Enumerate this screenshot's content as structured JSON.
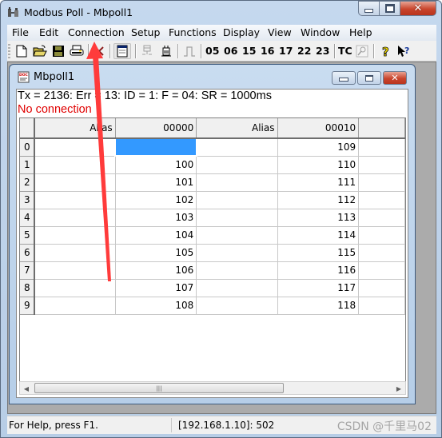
{
  "window": {
    "title": "Modbus Poll - Mbpoll1",
    "controls": {
      "minimize": "minimize",
      "maximize": "maximize",
      "close": "close"
    }
  },
  "menu": {
    "items": [
      {
        "label": "File"
      },
      {
        "label": "Edit"
      },
      {
        "label": "Connection"
      },
      {
        "label": "Setup"
      },
      {
        "label": "Functions"
      },
      {
        "label": "Display"
      },
      {
        "label": "View"
      },
      {
        "label": "Window"
      },
      {
        "label": "Help"
      }
    ]
  },
  "toolbar": {
    "icons": [
      "new-document-icon",
      "open-folder-icon",
      "save-icon",
      "print-icon",
      "delete-icon",
      "window-icon",
      "connect-icon",
      "disconnect-icon",
      "pulse-icon"
    ],
    "function_codes": [
      "05",
      "06",
      "15",
      "16",
      "17",
      "22",
      "23"
    ],
    "tc_label": "TC",
    "extra_icons": [
      "traffic-monitor-icon",
      "help-icon",
      "context-help-icon"
    ]
  },
  "child_window": {
    "title": "Mbpoll1",
    "status_line": "Tx = 2136: Err = 13: ID = 1: F = 04: SR = 1000ms",
    "error_line": "No connection",
    "error_color": "#e00000",
    "grid": {
      "columns": [
        {
          "label": "Alias"
        },
        {
          "label": "00000"
        },
        {
          "label": "Alias"
        },
        {
          "label": "00010"
        }
      ],
      "rows": [
        {
          "index": "0",
          "alias1": "",
          "value1": "",
          "alias2": "",
          "value2": "109",
          "selected": true
        },
        {
          "index": "1",
          "alias1": "",
          "value1": "100",
          "alias2": "",
          "value2": "110"
        },
        {
          "index": "2",
          "alias1": "",
          "value1": "101",
          "alias2": "",
          "value2": "111"
        },
        {
          "index": "3",
          "alias1": "",
          "value1": "102",
          "alias2": "",
          "value2": "112"
        },
        {
          "index": "4",
          "alias1": "",
          "value1": "103",
          "alias2": "",
          "value2": "113"
        },
        {
          "index": "5",
          "alias1": "",
          "value1": "104",
          "alias2": "",
          "value2": "114"
        },
        {
          "index": "6",
          "alias1": "",
          "value1": "105",
          "alias2": "",
          "value2": "115"
        },
        {
          "index": "7",
          "alias1": "",
          "value1": "106",
          "alias2": "",
          "value2": "116"
        },
        {
          "index": "8",
          "alias1": "",
          "value1": "107",
          "alias2": "",
          "value2": "117"
        },
        {
          "index": "9",
          "alias1": "",
          "value1": "108",
          "alias2": "",
          "value2": "118"
        }
      ],
      "selection_color": "#3399ff"
    }
  },
  "statusbar": {
    "help_text": "For Help, press F1.",
    "connection": "[192.168.1.10]: 502",
    "watermark": "CSDN @千里马02"
  },
  "annotation": {
    "type": "red-arrow",
    "points_to": "Connection",
    "color": "#ff3b3b"
  }
}
